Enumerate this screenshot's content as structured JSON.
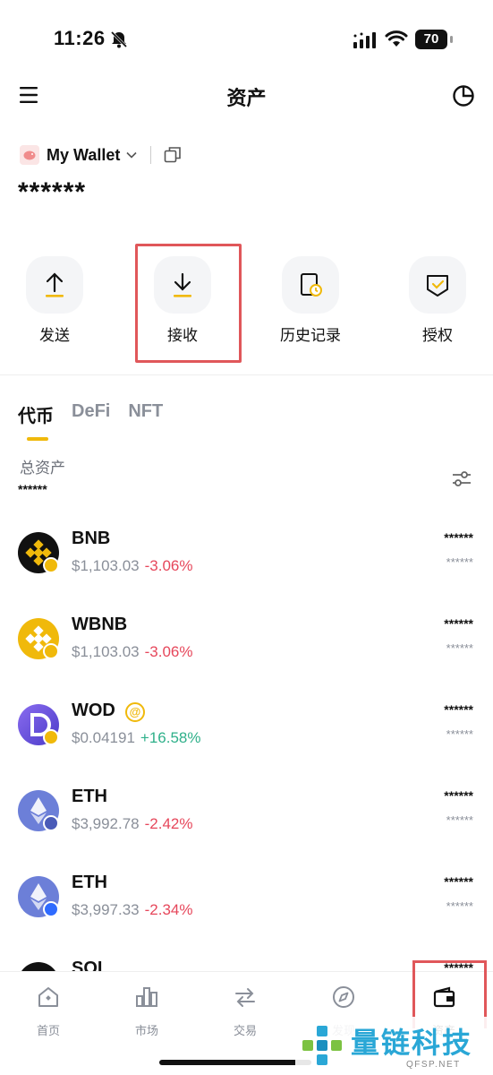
{
  "status_bar": {
    "time": "11:26",
    "battery": "70"
  },
  "header": {
    "title": "资产"
  },
  "wallet": {
    "name": "My Wallet",
    "balance_masked": "******"
  },
  "actions": [
    {
      "label": "发送",
      "icon": "arrow-up-icon"
    },
    {
      "label": "接收",
      "icon": "arrow-down-icon"
    },
    {
      "label": "历史记录",
      "icon": "history-icon"
    },
    {
      "label": "授权",
      "icon": "authorize-icon"
    }
  ],
  "tabs": [
    {
      "label": "代币",
      "active": true
    },
    {
      "label": "DeFi",
      "active": false
    },
    {
      "label": "NFT",
      "active": false
    }
  ],
  "total": {
    "label": "总资产",
    "value_masked": "******"
  },
  "tokens": [
    {
      "symbol": "BNB",
      "price": "$1,103.03",
      "change": "-3.06%",
      "amount": "******",
      "value": "******",
      "logo_color": "#111111",
      "badge_color": "#f0b90b"
    },
    {
      "symbol": "WBNB",
      "price": "$1,103.03",
      "change": "-3.06%",
      "amount": "******",
      "value": "******",
      "logo_color": "#f0b90b",
      "badge_color": "#f0b90b"
    },
    {
      "symbol": "WOD",
      "price": "$0.04191",
      "change": "+16.58%",
      "amount": "******",
      "value": "******",
      "logo_color": "#6b4fd8",
      "badge_color": "#f0b90b",
      "badge_label": "@"
    },
    {
      "symbol": "ETH",
      "price": "$3,992.78",
      "change": "-2.42%",
      "amount": "******",
      "value": "******",
      "logo_color": "#6c7fd8",
      "badge_color": "#4a5bb8"
    },
    {
      "symbol": "ETH",
      "price": "$3,997.33",
      "change": "-2.34%",
      "amount": "******",
      "value": "******",
      "logo_color": "#6c7fd8",
      "badge_color": "#2f6bff"
    },
    {
      "symbol": "SOL",
      "amount": "******"
    }
  ],
  "bottom_nav": [
    {
      "label": "首页",
      "icon": "home-icon",
      "active": false
    },
    {
      "label": "市场",
      "icon": "market-icon",
      "active": false
    },
    {
      "label": "交易",
      "icon": "trade-icon",
      "active": false
    },
    {
      "label": "发现",
      "icon": "discover-icon",
      "active": false
    },
    {
      "label": "资产",
      "icon": "wallet-icon",
      "active": true
    }
  ],
  "watermark": {
    "text": "量链科技",
    "domain": "QFSP.NET"
  },
  "colors": {
    "accent": "#f0b90b",
    "negative": "#e6475b",
    "positive": "#2fb08a",
    "highlight": "#e0575a"
  }
}
